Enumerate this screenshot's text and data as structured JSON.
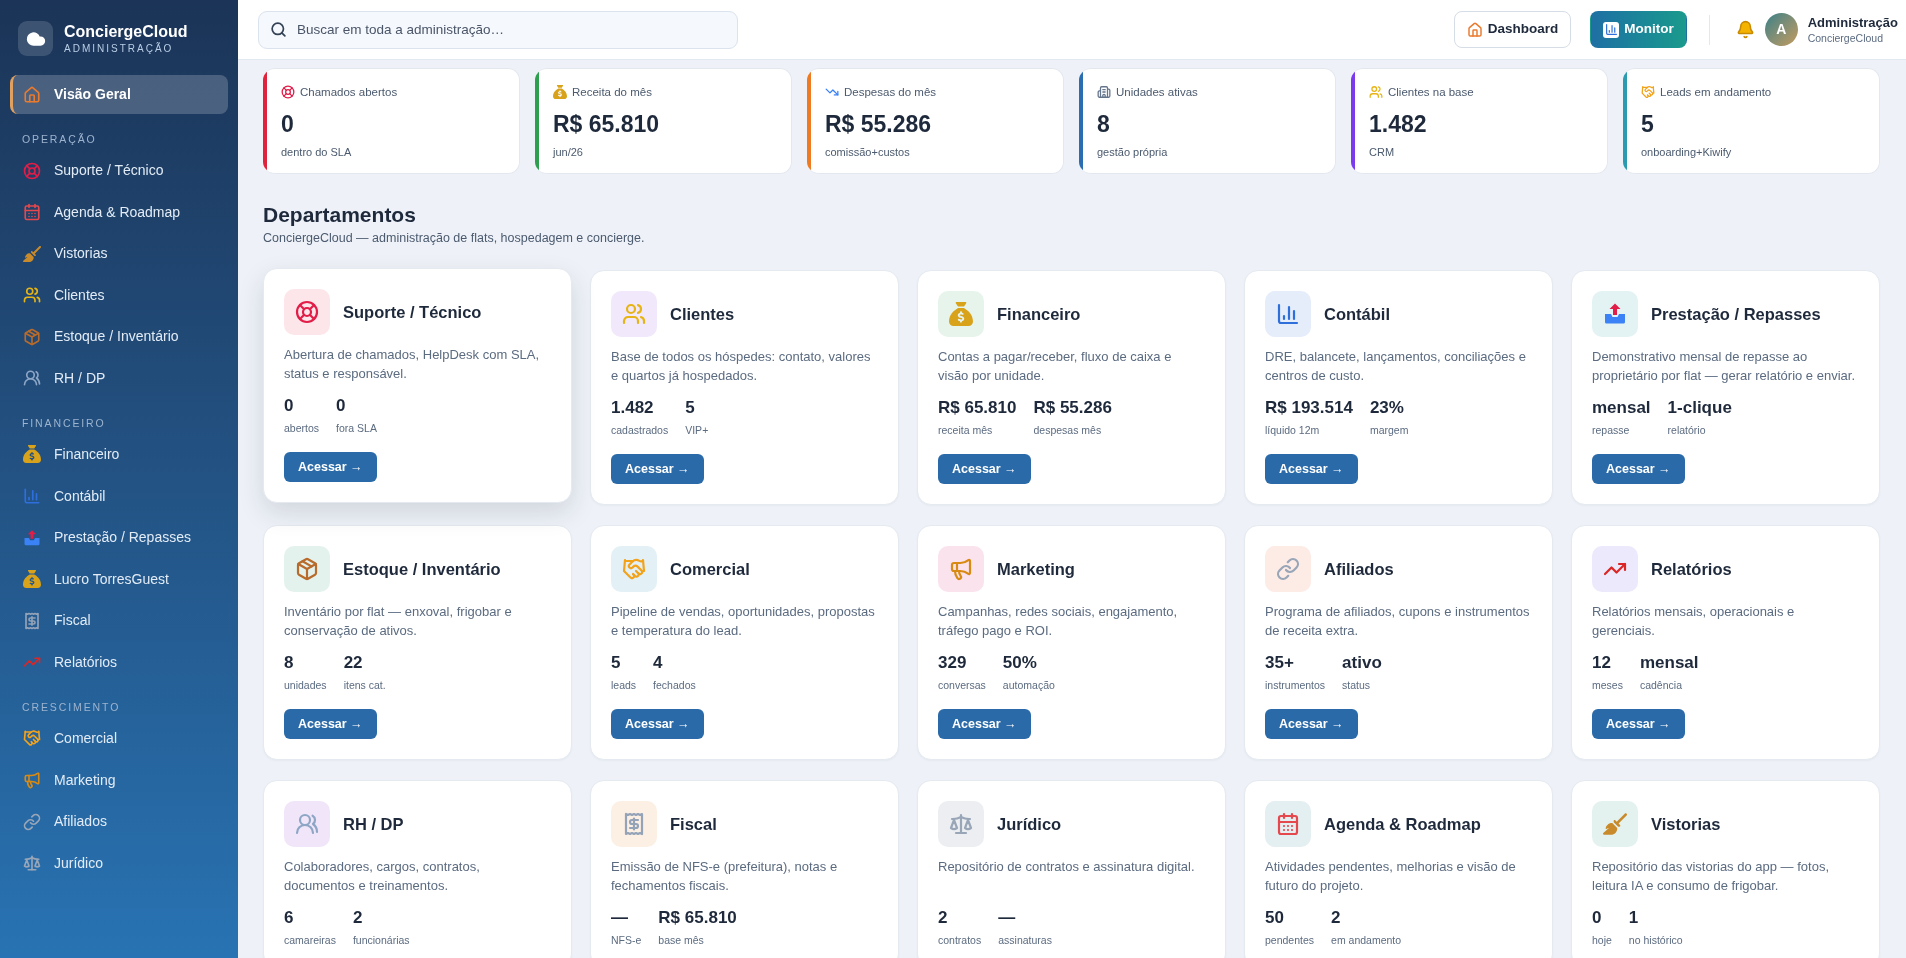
{
  "sidebar": {
    "brand": {
      "name": "ConciergeCloud",
      "subtitle": "ADMINISTRAÇÃO"
    },
    "sections": [
      {
        "items": [
          {
            "label": "Visão Geral",
            "selected": true
          }
        ]
      },
      {
        "title": "OPERAÇÃO",
        "items": [
          {
            "label": "Suporte / Técnico",
            "selected": false
          },
          {
            "label": "Agenda & Roadmap",
            "selected": false
          },
          {
            "label": "Vistorias",
            "selected": false
          },
          {
            "label": "Clientes",
            "selected": false
          },
          {
            "label": "Estoque / Inventário",
            "selected": false
          },
          {
            "label": "RH / DP",
            "selected": false
          }
        ]
      },
      {
        "title": "FINANCEIRO",
        "items": [
          {
            "label": "Financeiro",
            "selected": false
          },
          {
            "label": "Contábil",
            "selected": false
          },
          {
            "label": "Prestação / Repasses",
            "selected": false
          },
          {
            "label": "Lucro TorresGuest",
            "selected": false
          },
          {
            "label": "Fiscal",
            "selected": false
          },
          {
            "label": "Relatórios",
            "selected": false
          }
        ]
      },
      {
        "title": "CRESCIMENTO",
        "items": [
          {
            "label": "Comercial",
            "selected": false
          },
          {
            "label": "Marketing",
            "selected": false
          },
          {
            "label": "Afiliados",
            "selected": false
          },
          {
            "label": "Jurídico",
            "selected": false
          }
        ]
      }
    ]
  },
  "topbar": {
    "search": {
      "placeholder": "Buscar em toda a administração…"
    },
    "buttons": [
      {
        "label": "Dashboard",
        "kind": "secondary"
      },
      {
        "label": "Monitor",
        "kind": "primary"
      }
    ],
    "user": {
      "initial": "A",
      "name": "Administração",
      "organization": "ConciergeCloud"
    }
  },
  "kpis": [
    {
      "label": "Chamados abertos",
      "value": "0",
      "note": "dentro do SLA",
      "color": "#e0233d"
    },
    {
      "label": "Receita do mês",
      "value": "R$ 65.810",
      "note": "jun/26",
      "color": "#2e9e4f"
    },
    {
      "label": "Despesas do mês",
      "value": "R$ 55.286",
      "note": "comissão+custos",
      "color": "#ee7a22"
    },
    {
      "label": "Unidades ativas",
      "value": "8",
      "note": "gestão própria",
      "color": "#2a6db0"
    },
    {
      "label": "Clientes na base",
      "value": "1.482",
      "note": "CRM",
      "color": "#7c3aed"
    },
    {
      "label": "Leads em andamento",
      "value": "5",
      "note": "onboarding+Kiwify",
      "color": "#2a9bb0"
    }
  ],
  "departments_header": {
    "title": "Departamentos",
    "subtitle": "ConciergeCloud — administração de flats, hospedagem e concierge."
  },
  "departments": [
    {
      "title": "Suporte / Técnico",
      "description": "Abertura de chamados, HelpDesk com SLA, status e responsável.",
      "stats": [
        {
          "value": "0",
          "label": "abertos"
        },
        {
          "value": "0",
          "label": "fora SLA"
        }
      ],
      "button": "Acessar →",
      "color": "#fde6ea",
      "hovered": true
    },
    {
      "title": "Clientes",
      "description": "Base de todos os hóspedes: contato, valores e quartos já hospedados.",
      "stats": [
        {
          "value": "1.482",
          "label": "cadastrados"
        },
        {
          "value": "5",
          "label": "VIP+"
        }
      ],
      "button": "Acessar →",
      "color": "#f1e9fb",
      "hovered": false
    },
    {
      "title": "Financeiro",
      "description": "Contas a pagar/receber, fluxo de caixa e visão por unidade.",
      "stats": [
        {
          "value": "R$ 65.810",
          "label": "receita mês"
        },
        {
          "value": "R$ 55.286",
          "label": "despesas mês"
        }
      ],
      "button": "Acessar →",
      "color": "#e7f4ec",
      "hovered": false
    },
    {
      "title": "Contábil",
      "description": "DRE, balancete, lançamentos, conciliações e centros de custo.",
      "stats": [
        {
          "value": "R$ 193.514",
          "label": "líquido 12m"
        },
        {
          "value": "23%",
          "label": "margem"
        }
      ],
      "button": "Acessar →",
      "color": "#e5edfb",
      "hovered": false
    },
    {
      "title": "Prestação / Repasses",
      "description": "Demonstrativo mensal de repasse ao proprietário por flat — gerar relatório e enviar.",
      "stats": [
        {
          "value": "mensal",
          "label": "repasse"
        },
        {
          "value": "1-clique",
          "label": "relatório"
        }
      ],
      "button": "Acessar →",
      "color": "#e3f2f3",
      "hovered": false
    },
    {
      "title": "Estoque / Inventário",
      "description": "Inventário por flat — enxoval, frigobar e conservação de ativos.",
      "stats": [
        {
          "value": "8",
          "label": "unidades"
        },
        {
          "value": "22",
          "label": "itens cat."
        }
      ],
      "button": "Acessar →",
      "color": "#e4f2ee",
      "hovered": false
    },
    {
      "title": "Comercial",
      "description": "Pipeline de vendas, oportunidades, propostas e temperatura do lead.",
      "stats": [
        {
          "value": "5",
          "label": "leads"
        },
        {
          "value": "4",
          "label": "fechados"
        }
      ],
      "button": "Acessar →",
      "color": "#e3f1f6",
      "hovered": false
    },
    {
      "title": "Marketing",
      "description": "Campanhas, redes sociais, engajamento, tráfego pago e ROI.",
      "stats": [
        {
          "value": "329",
          "label": "conversas"
        },
        {
          "value": "50%",
          "label": "automação"
        }
      ],
      "button": "Acessar →",
      "color": "#fbe3ee",
      "hovered": false
    },
    {
      "title": "Afiliados",
      "description": "Programa de afiliados, cupons e instrumentos de receita extra.",
      "stats": [
        {
          "value": "35+",
          "label": "instrumentos"
        },
        {
          "value": "ativo",
          "label": "status"
        }
      ],
      "button": "Acessar →",
      "color": "#fdebe6",
      "hovered": false
    },
    {
      "title": "Relatórios",
      "description": "Relatórios mensais, operacionais e gerenciais.",
      "stats": [
        {
          "value": "12",
          "label": "meses"
        },
        {
          "value": "mensal",
          "label": "cadência"
        }
      ],
      "button": "Acessar →",
      "color": "#ebe9fb",
      "hovered": false
    },
    {
      "title": "RH / DP",
      "description": "Colaboradores, cargos, contratos, documentos e treinamentos.",
      "stats": [
        {
          "value": "6",
          "label": "camareiras"
        },
        {
          "value": "2",
          "label": "funcionárias"
        }
      ],
      "color": "#f1e6f9",
      "hovered": false
    },
    {
      "title": "Fiscal",
      "description": "Emissão de NFS-e (prefeitura), notas e fechamentos fiscais.",
      "stats": [
        {
          "value": "—",
          "label": "NFS-e"
        },
        {
          "value": "R$ 65.810",
          "label": "base mês"
        }
      ],
      "color": "#fcefe4",
      "hovered": false
    },
    {
      "title": "Jurídico",
      "description": "Repositório de contratos e assinatura digital.",
      "stats": [
        {
          "value": "2",
          "label": "contratos"
        },
        {
          "value": "—",
          "label": "assinaturas"
        }
      ],
      "color": "#eceef1",
      "hovered": false
    },
    {
      "title": "Agenda & Roadmap",
      "description": "Atividades pendentes, melhorias e visão de futuro do projeto.",
      "stats": [
        {
          "value": "50",
          "label": "pendentes"
        },
        {
          "value": "2",
          "label": "em andamento"
        }
      ],
      "color": "#e4eff2",
      "hovered": false
    },
    {
      "title": "Vistorias",
      "description": "Repositório das vistorias do app — fotos, leitura IA e consumo de frigobar.",
      "stats": [
        {
          "value": "0",
          "label": "hoje"
        },
        {
          "value": "1",
          "label": "no histórico"
        }
      ],
      "color": "#e4f2ef",
      "hovered": false
    }
  ]
}
